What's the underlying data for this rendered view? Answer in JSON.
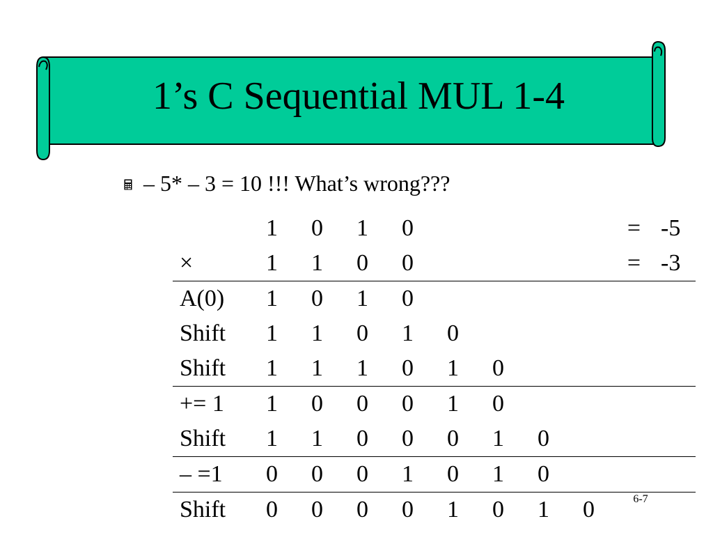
{
  "slide": {
    "title": "1’s C Sequential MUL 1-4",
    "bullet_icon": "calculator-icon",
    "bullet_text": "– 5* – 3 = 10 !!! What’s wrong???",
    "page_number": "6-7"
  },
  "colors": {
    "banner_fill": "#00CC99",
    "banner_outline": "#000000"
  },
  "table": {
    "rows": [
      {
        "label": "",
        "bits": [
          "1",
          "0",
          "1",
          "0",
          "",
          "",
          "",
          ""
        ],
        "eq": "=",
        "value": "-5",
        "sep": false
      },
      {
        "label": "×",
        "bits": [
          "1",
          "1",
          "0",
          "0",
          "",
          "",
          "",
          ""
        ],
        "eq": "=",
        "value": "-3",
        "sep": false
      },
      {
        "label": "A(0)",
        "bits": [
          "1",
          "0",
          "1",
          "0",
          "",
          "",
          "",
          ""
        ],
        "eq": "",
        "value": "",
        "sep": true
      },
      {
        "label": "Shift",
        "bits": [
          "1",
          "1",
          "0",
          "1",
          "0",
          "",
          "",
          ""
        ],
        "eq": "",
        "value": "",
        "sep": false
      },
      {
        "label": "Shift",
        "bits": [
          "1",
          "1",
          "1",
          "0",
          "1",
          "0",
          "",
          ""
        ],
        "eq": "",
        "value": "",
        "sep": false
      },
      {
        "label": "+= 1",
        "bits": [
          "1",
          "0",
          "0",
          "0",
          "1",
          "0",
          "",
          ""
        ],
        "eq": "",
        "value": "",
        "sep": true
      },
      {
        "label": "Shift",
        "bits": [
          "1",
          "1",
          "0",
          "0",
          "0",
          "1",
          "0",
          ""
        ],
        "eq": "",
        "value": "",
        "sep": false
      },
      {
        "label": "– =1",
        "bits": [
          "0",
          "0",
          "0",
          "1",
          "0",
          "1",
          "0",
          ""
        ],
        "eq": "",
        "value": "",
        "sep": true
      },
      {
        "label": "Shift",
        "bits": [
          "0",
          "0",
          "0",
          "0",
          "1",
          "0",
          "1",
          "0"
        ],
        "eq": "",
        "value": "",
        "sep": true
      }
    ]
  }
}
